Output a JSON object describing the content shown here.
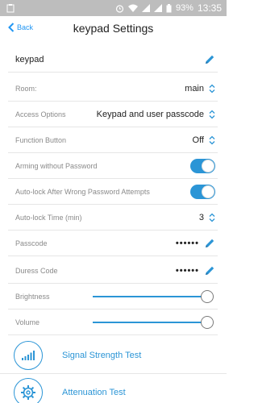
{
  "status_bar": {
    "battery": "93%",
    "time": "13:35"
  },
  "header": {
    "back_label": "Back",
    "title": "keypad Settings"
  },
  "device_name": "keypad",
  "rows": {
    "room": {
      "label": "Room:",
      "value": "main"
    },
    "access": {
      "label": "Access Options",
      "value": "Keypad and user passcode"
    },
    "function_button": {
      "label": "Function Button",
      "value": "Off"
    },
    "arming": {
      "label": "Arming without Password",
      "enabled": true
    },
    "autolock_wrong": {
      "label": "Auto-lock After Wrong Password Attempts",
      "enabled": true
    },
    "autolock_time": {
      "label": "Auto-lock Time (min)",
      "value": "3"
    },
    "passcode": {
      "label": "Passcode",
      "value": "••••••"
    },
    "duress": {
      "label": "Duress Code",
      "value": "••••••"
    },
    "brightness": {
      "label": "Brightness",
      "level_percent": 100
    },
    "volume": {
      "label": "Volume",
      "level_percent": 100
    }
  },
  "actions": {
    "signal": {
      "label": "Signal Strength Test"
    },
    "attenuation": {
      "label": "Attenuation Test"
    }
  },
  "colors": {
    "accent": "#2b95d6",
    "status_bar": "#bdbdbd"
  }
}
